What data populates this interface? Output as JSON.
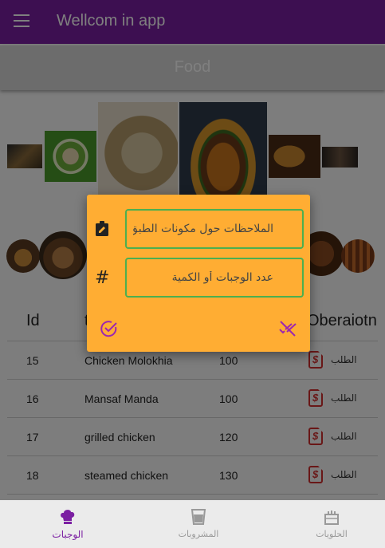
{
  "appbar": {
    "title": "Wellcom in app",
    "menu_icon": "menu-icon"
  },
  "section": {
    "title": "Food"
  },
  "table": {
    "headers": [
      "Id",
      "t",
      "",
      "Oberaiotn"
    ],
    "rows": [
      {
        "id": "15",
        "name": "Chicken Molokhia",
        "price": "100",
        "operation": "الطلب"
      },
      {
        "id": "16",
        "name": "Mansaf Manda",
        "price": "100",
        "operation": "الطلب"
      },
      {
        "id": "17",
        "name": "grilled chicken",
        "price": "120",
        "operation": "الطلب"
      },
      {
        "id": "18",
        "name": "steamed chicken",
        "price": "130",
        "operation": "الطلب"
      }
    ]
  },
  "dialog": {
    "notes_placeholder": "الملاحظات حول مكونات الطبق",
    "quantity_placeholder": "عدد الوجبات أو الكمية",
    "notes_value": "",
    "quantity_value": "",
    "hash_symbol": "#"
  },
  "bottom_nav": {
    "items": [
      {
        "label": "الوجبات",
        "icon": "chef-hat-icon",
        "active": true
      },
      {
        "label": "المشروبات",
        "icon": "cup-icon",
        "active": false
      },
      {
        "label": "الحلويات",
        "icon": "cake-icon",
        "active": false
      }
    ]
  },
  "colors": {
    "primary": "#7b1fa2",
    "dialog_bg": "#ffad33",
    "field_border": "#4caf50",
    "icon_red": "#d32f2f"
  }
}
